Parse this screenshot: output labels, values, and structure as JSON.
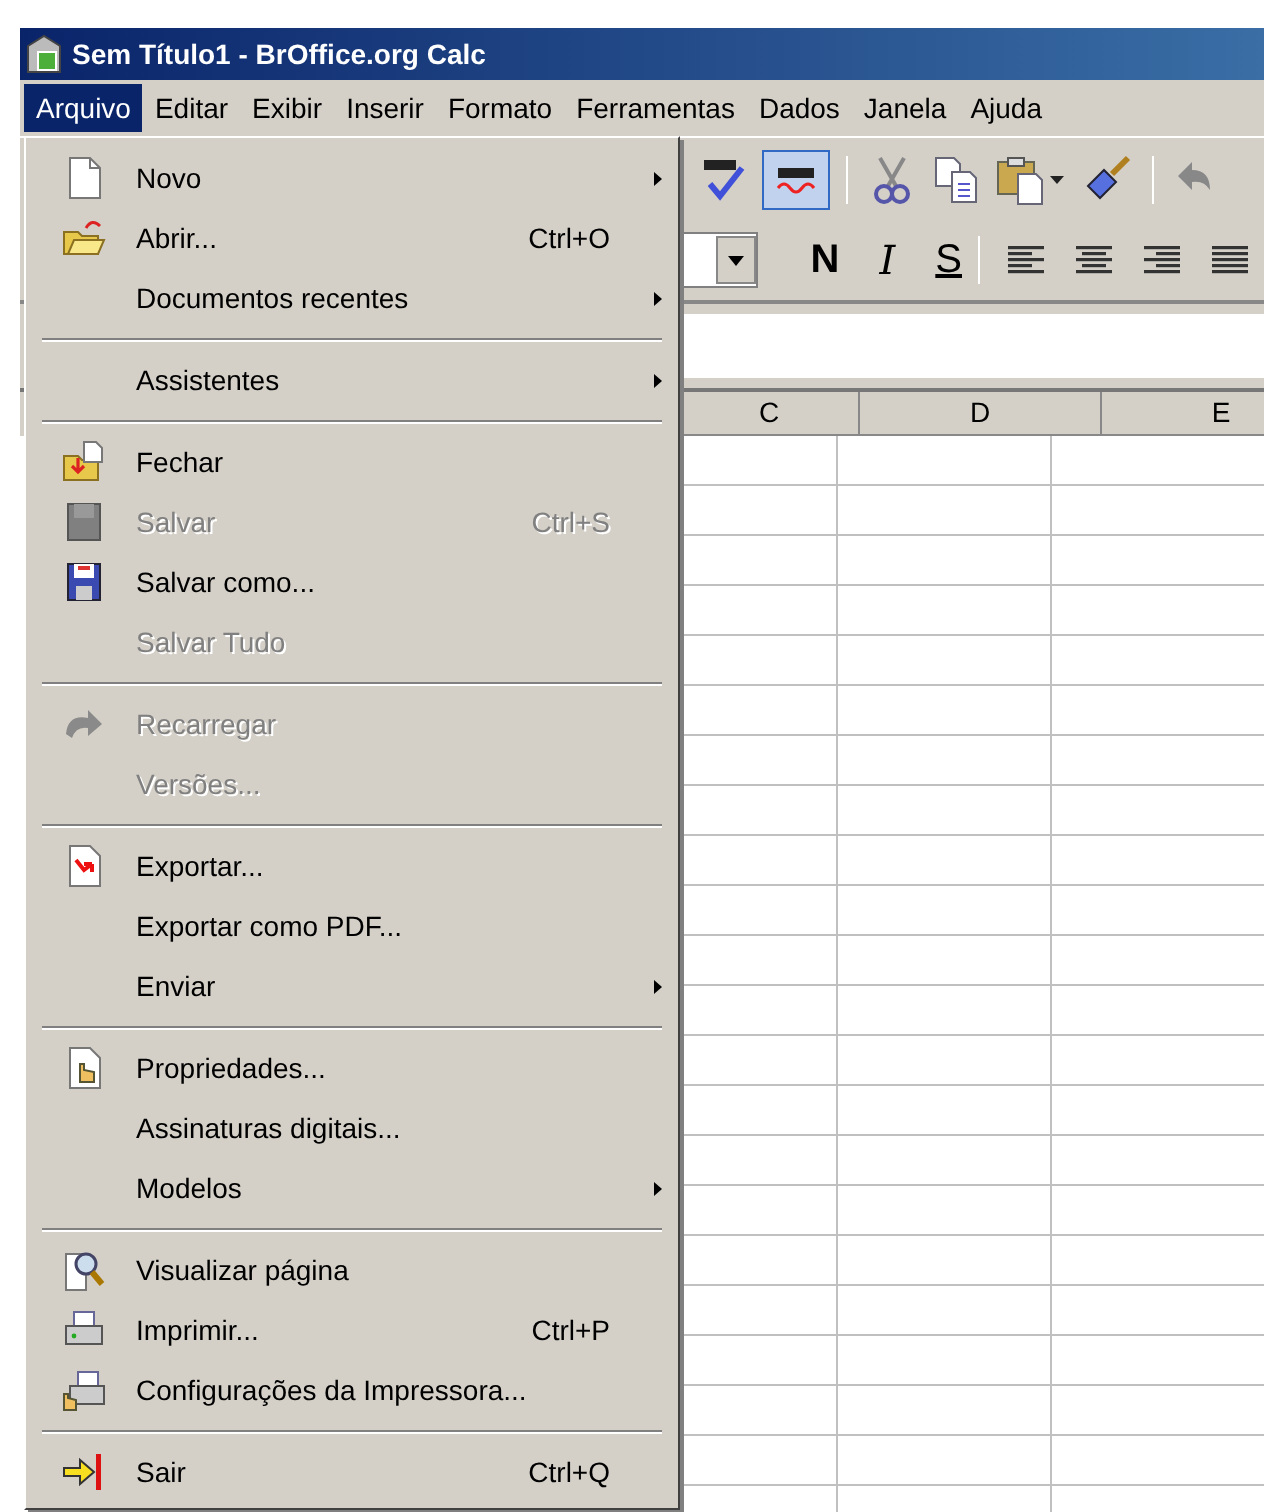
{
  "window": {
    "title": "Sem Título1 - BrOffice.org Calc"
  },
  "menubar": [
    {
      "label": "Arquivo",
      "selected": true
    },
    {
      "label": "Editar",
      "selected": false
    },
    {
      "label": "Exibir",
      "selected": false
    },
    {
      "label": "Inserir",
      "selected": false
    },
    {
      "label": "Formato",
      "selected": false
    },
    {
      "label": "Ferramentas",
      "selected": false
    },
    {
      "label": "Dados",
      "selected": false
    },
    {
      "label": "Janela",
      "selected": false
    },
    {
      "label": "Ajuda",
      "selected": false
    }
  ],
  "standard_toolbar": [
    {
      "kind": "spellcheck",
      "pressed": false
    },
    {
      "kind": "autospell",
      "pressed": true
    },
    {
      "kind": "cut",
      "pressed": false
    },
    {
      "kind": "copy",
      "pressed": false
    },
    {
      "kind": "paste",
      "pressed": false
    },
    {
      "kind": "brush",
      "pressed": false
    },
    {
      "kind": "undo",
      "pressed": false
    }
  ],
  "formatting_toolbar": [
    {
      "kind": "bold",
      "label": "N"
    },
    {
      "kind": "italic",
      "label": "I"
    },
    {
      "kind": "underline",
      "label": "S"
    }
  ],
  "columns": [
    "C",
    "D",
    "E"
  ],
  "file_menu": [
    {
      "kind": "new",
      "label": "Novo",
      "submenu": true,
      "disabled": false
    },
    {
      "kind": "open",
      "label": "Abrir...",
      "shortcut": "Ctrl+O",
      "submenu": false,
      "disabled": false
    },
    {
      "kind": "plain",
      "label": "Documentos recentes",
      "submenu": true,
      "disabled": false
    },
    {
      "kind": "separator"
    },
    {
      "kind": "plain",
      "label": "Assistentes",
      "submenu": true,
      "disabled": false
    },
    {
      "kind": "separator"
    },
    {
      "kind": "close",
      "label": "Fechar",
      "submenu": false,
      "disabled": false
    },
    {
      "kind": "save",
      "label": "Salvar",
      "shortcut": "Ctrl+S",
      "submenu": false,
      "disabled": true
    },
    {
      "kind": "saveas",
      "label": "Salvar como...",
      "submenu": false,
      "disabled": false
    },
    {
      "kind": "plain",
      "label": "Salvar Tudo",
      "submenu": false,
      "disabled": true
    },
    {
      "kind": "separator"
    },
    {
      "kind": "reload",
      "label": "Recarregar",
      "submenu": false,
      "disabled": true
    },
    {
      "kind": "plain",
      "label": "Versões...",
      "submenu": false,
      "disabled": true
    },
    {
      "kind": "separator"
    },
    {
      "kind": "export",
      "label": "Exportar...",
      "submenu": false,
      "disabled": false
    },
    {
      "kind": "plain",
      "label": "Exportar como PDF...",
      "submenu": false,
      "disabled": false
    },
    {
      "kind": "plain",
      "label": "Enviar",
      "submenu": true,
      "disabled": false
    },
    {
      "kind": "separator"
    },
    {
      "kind": "properties",
      "label": "Propriedades...",
      "submenu": false,
      "disabled": false
    },
    {
      "kind": "plain",
      "label": "Assinaturas digitais...",
      "submenu": false,
      "disabled": false
    },
    {
      "kind": "plain",
      "label": "Modelos",
      "submenu": true,
      "disabled": false
    },
    {
      "kind": "separator"
    },
    {
      "kind": "preview",
      "label": "Visualizar página",
      "submenu": false,
      "disabled": false
    },
    {
      "kind": "print",
      "label": "Imprimir...",
      "shortcut": "Ctrl+P",
      "submenu": false,
      "disabled": false
    },
    {
      "kind": "printersettings",
      "label": "Configurações da Impressora...",
      "submenu": false,
      "disabled": false
    },
    {
      "kind": "separator"
    },
    {
      "kind": "exit",
      "label": "Sair",
      "shortcut": "Ctrl+Q",
      "submenu": false,
      "disabled": false
    }
  ]
}
